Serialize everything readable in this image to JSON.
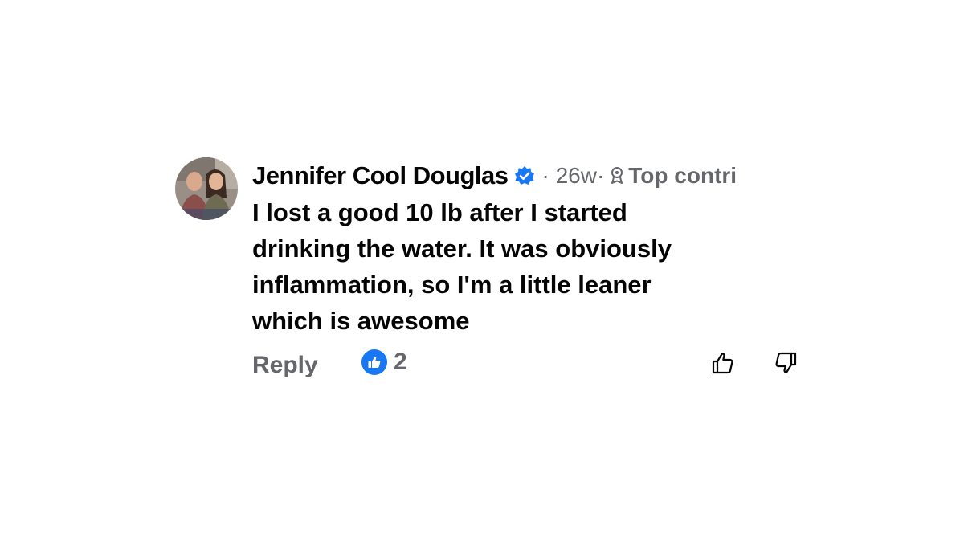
{
  "comment": {
    "author": "Jennifer Cool Douglas",
    "verified": true,
    "age": "· 26w·",
    "badge_label": "Top contri",
    "text_lines": [
      "I lost a good 10 lb after I started",
      "drinking the water. It was obviously",
      "inflammation, so I'm a little leaner",
      "which is awesome"
    ],
    "actions": {
      "reply_label": "Reply",
      "reaction_count": "2"
    }
  },
  "colors": {
    "text_primary": "#050505",
    "text_secondary": "#65676b",
    "accent_blue": "#1877f2"
  },
  "icons": {
    "verified": "verified-badge-icon",
    "top_contributor": "top-contributor-icon",
    "like_reaction": "like-reaction-icon",
    "thumb_up": "thumbs-up-icon",
    "thumb_down": "thumbs-down-icon"
  }
}
